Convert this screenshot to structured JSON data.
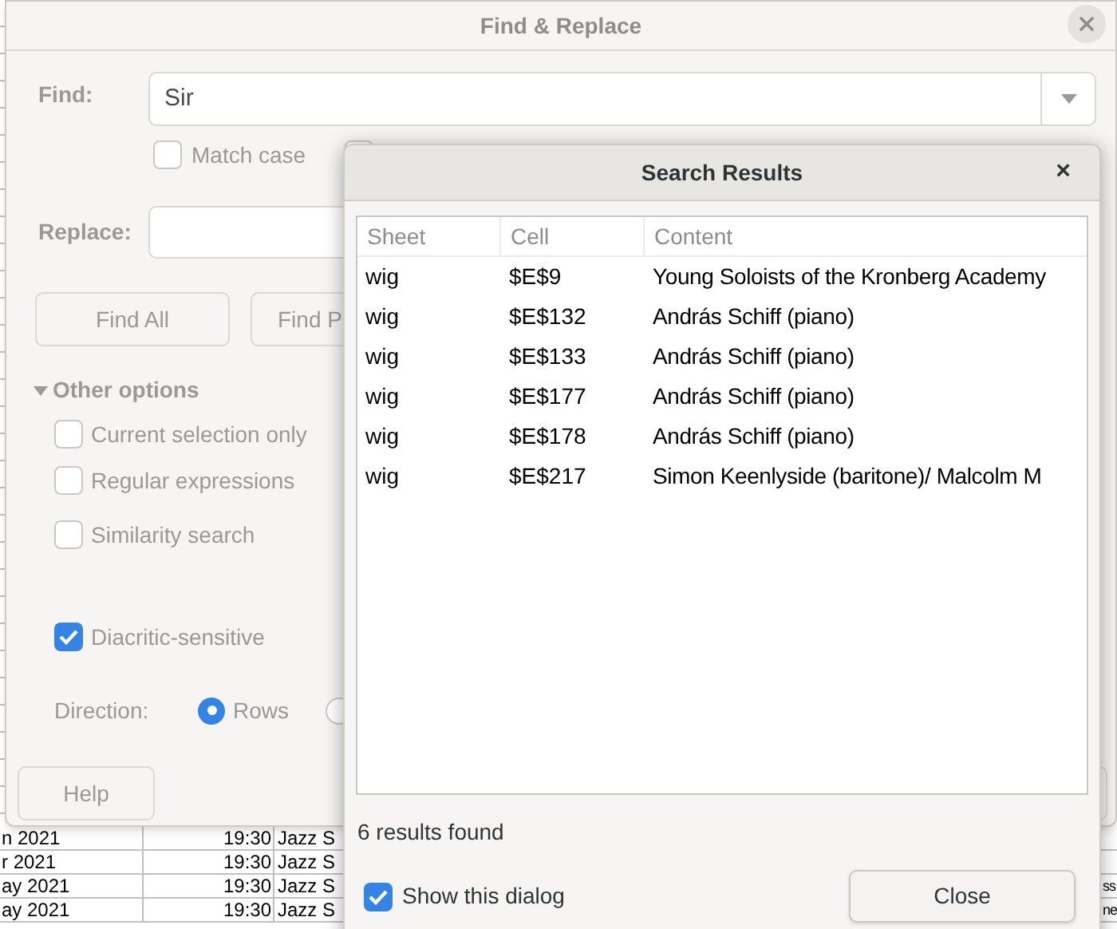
{
  "sheet_rows": [
    {
      "column_1": "n 2021",
      "column_2": "19:30",
      "column_3": "Jazz S"
    },
    {
      "column_1": "r 2021",
      "column_2": "19:30",
      "column_3": "Jazz S"
    },
    {
      "column_1": "ay 2021",
      "column_2": "19:30",
      "column_3": "Jazz S",
      "column_4": "ss"
    },
    {
      "column_1": "ay 2021",
      "column_2": "19:30",
      "column_3": "Jazz S",
      "column_4": "ne"
    }
  ],
  "find_replace": {
    "title": "Find & Replace",
    "find_label": "Find:",
    "find_value": "Sir",
    "match_case": {
      "label": "Match case",
      "checked": false
    },
    "covered_option": {
      "checked": false
    },
    "replace_label": "Replace:",
    "buttons": [
      "Find All",
      "Find P"
    ],
    "other_options": {
      "label": "Other options",
      "expanded": true
    },
    "options": [
      {
        "label": "Current selection only",
        "checked": false
      },
      {
        "label": "Regular expressions",
        "checked": false
      },
      {
        "label": "Similarity search",
        "checked": false
      },
      {
        "label": "Diacritic-sensitive",
        "checked": true
      }
    ],
    "direction_label": "Direction:",
    "directions": [
      {
        "label": "Rows",
        "selected": true
      },
      {
        "selected": false
      }
    ],
    "help": "Help"
  },
  "search_results": {
    "title": "Search Results",
    "close_glyph": "×",
    "columns": [
      "Sheet",
      "Cell",
      "Content"
    ],
    "rows": [
      [
        "wig",
        "$E$9",
        "Young Soloists of the Kronberg Academy"
      ],
      [
        "wig",
        "$E$132",
        "András Schiff (piano)"
      ],
      [
        "wig",
        "$E$133",
        "András Schiff (piano)"
      ],
      [
        "wig",
        "$E$177",
        "András Schiff (piano)"
      ],
      [
        "wig",
        "$E$178",
        "András Schiff (piano)"
      ],
      [
        "wig",
        "$E$217",
        "Simon Keenlyside (baritone)/ Malcolm M"
      ]
    ],
    "status": "6 results found",
    "show_dialog": {
      "label": "Show this dialog",
      "checked": true
    },
    "close_button": "Close"
  }
}
